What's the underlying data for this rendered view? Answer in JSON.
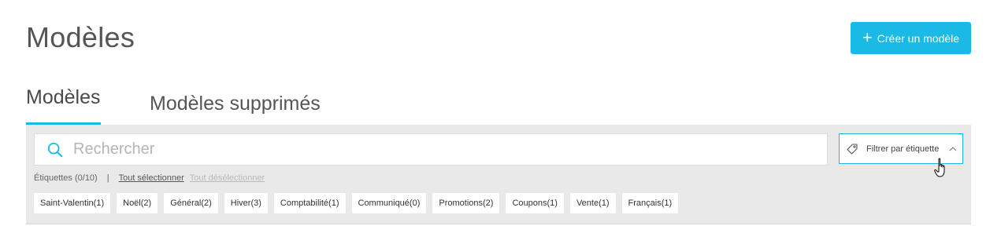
{
  "header": {
    "title": "Modèles",
    "create_button": {
      "plus": "+",
      "label": "Créer un modèle"
    }
  },
  "tabs": [
    {
      "label": "Modèles",
      "active": true
    },
    {
      "label": "Modèles supprimés",
      "active": false
    }
  ],
  "search": {
    "placeholder": "Rechercher",
    "value": ""
  },
  "filter_button": {
    "label": "Filtrer par étiquette"
  },
  "tags_bar": {
    "count_label": "Étiquettes (0/10)",
    "separator": "|",
    "select_all": "Tout sélectionner",
    "deselect_all": "Tout désélectionner"
  },
  "tags": [
    "Saint-Valentin(1)",
    "Noël(2)",
    "Général(2)",
    "Hiver(3)",
    "Comptabilité(1)",
    "Communiqué(0)",
    "Promotions(2)",
    "Coupons(1)",
    "Vente(1)",
    "Français(1)"
  ],
  "colors": {
    "accent": "#1ab9e6",
    "panel_bg": "#e9e9e9",
    "disabled_link": "#b9b9b9"
  },
  "icons": [
    "plus-icon",
    "search-icon",
    "tag-icon",
    "chevron-up-icon",
    "hand-cursor-icon"
  ]
}
